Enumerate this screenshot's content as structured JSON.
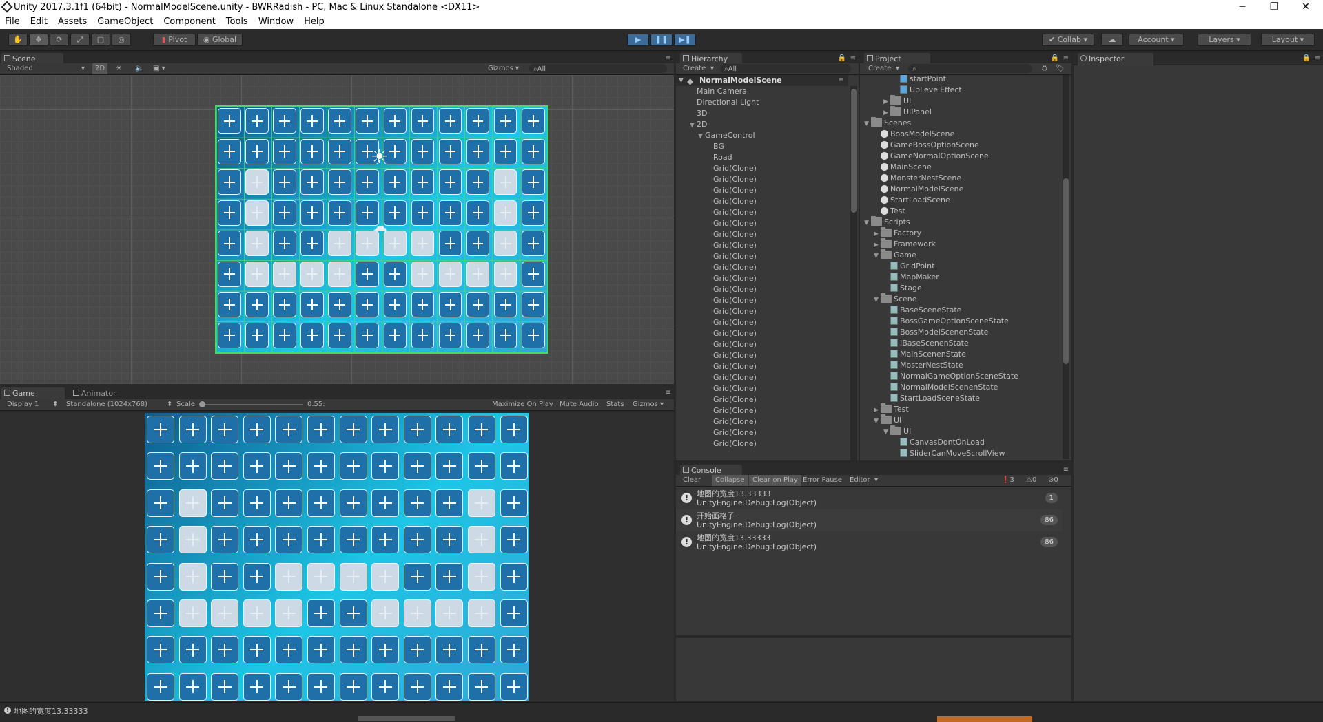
{
  "window": {
    "title": "Unity 2017.3.1f1 (64bit) - NormalModelScene.unity - BWRRadish - PC, Mac & Linux Standalone <DX11>",
    "min": "─",
    "max": "❐",
    "close": "✕"
  },
  "menu": [
    "File",
    "Edit",
    "Assets",
    "GameObject",
    "Component",
    "Tools",
    "Window",
    "Help"
  ],
  "toolbar": {
    "pivot": "Pivot",
    "global": "Global",
    "collab": "Collab",
    "account": "Account",
    "layers": "Layers",
    "layout": "Layout"
  },
  "scene": {
    "tab": "Scene",
    "shading": "Shaded",
    "mode2d": "2D",
    "gizmos": "Gizmos",
    "search": "All"
  },
  "game": {
    "tab": "Game",
    "tab2": "Animator",
    "display": "Display 1",
    "resolution": "Standalone (1024x768)",
    "scale_label": "Scale",
    "scale_value": "0.55:",
    "maximize": "Maximize On Play",
    "mute": "Mute Audio",
    "stats": "Stats",
    "gizmos": "Gizmos"
  },
  "hierarchy": {
    "tab": "Hierarchy",
    "create": "Create",
    "search": "All",
    "scene_name": "NormalModelScene",
    "items": [
      {
        "label": "Main Camera",
        "indent": 1
      },
      {
        "label": "Directional Light",
        "indent": 1
      },
      {
        "label": "3D",
        "indent": 1
      },
      {
        "label": "2D",
        "indent": 1,
        "arrow": "▼"
      },
      {
        "label": "GameControl",
        "indent": 2,
        "arrow": "▼"
      },
      {
        "label": "BG",
        "indent": 3
      },
      {
        "label": "Road",
        "indent": 3
      },
      {
        "label": "Grid(Clone)",
        "indent": 3
      },
      {
        "label": "Grid(Clone)",
        "indent": 3
      },
      {
        "label": "Grid(Clone)",
        "indent": 3
      },
      {
        "label": "Grid(Clone)",
        "indent": 3
      },
      {
        "label": "Grid(Clone)",
        "indent": 3
      },
      {
        "label": "Grid(Clone)",
        "indent": 3
      },
      {
        "label": "Grid(Clone)",
        "indent": 3
      },
      {
        "label": "Grid(Clone)",
        "indent": 3
      },
      {
        "label": "Grid(Clone)",
        "indent": 3
      },
      {
        "label": "Grid(Clone)",
        "indent": 3
      },
      {
        "label": "Grid(Clone)",
        "indent": 3
      },
      {
        "label": "Grid(Clone)",
        "indent": 3
      },
      {
        "label": "Grid(Clone)",
        "indent": 3
      },
      {
        "label": "Grid(Clone)",
        "indent": 3
      },
      {
        "label": "Grid(Clone)",
        "indent": 3
      },
      {
        "label": "Grid(Clone)",
        "indent": 3
      },
      {
        "label": "Grid(Clone)",
        "indent": 3
      },
      {
        "label": "Grid(Clone)",
        "indent": 3
      },
      {
        "label": "Grid(Clone)",
        "indent": 3
      },
      {
        "label": "Grid(Clone)",
        "indent": 3
      },
      {
        "label": "Grid(Clone)",
        "indent": 3
      },
      {
        "label": "Grid(Clone)",
        "indent": 3
      },
      {
        "label": "Grid(Clone)",
        "indent": 3
      },
      {
        "label": "Grid(Clone)",
        "indent": 3
      },
      {
        "label": "Grid(Clone)",
        "indent": 3
      },
      {
        "label": "Grid(Clone)",
        "indent": 3
      }
    ]
  },
  "project": {
    "tab": "Project",
    "create": "Create",
    "items": [
      {
        "label": "startPoint",
        "indent": 3,
        "icon": "prefab"
      },
      {
        "label": "UpLevelEffect",
        "indent": 3,
        "icon": "prefab"
      },
      {
        "label": "UI",
        "indent": 2,
        "icon": "folder",
        "arrow": "▶"
      },
      {
        "label": "UIPanel",
        "indent": 2,
        "icon": "folder",
        "arrow": "▶"
      },
      {
        "label": "Scenes",
        "indent": 0,
        "icon": "folder",
        "arrow": "▼"
      },
      {
        "label": "BoosModelScene",
        "indent": 1,
        "icon": "scene"
      },
      {
        "label": "GameBossOptionScene",
        "indent": 1,
        "icon": "scene"
      },
      {
        "label": "GameNormalOptionScene",
        "indent": 1,
        "icon": "scene"
      },
      {
        "label": "MainScene",
        "indent": 1,
        "icon": "scene"
      },
      {
        "label": "MonsterNestScene",
        "indent": 1,
        "icon": "scene"
      },
      {
        "label": "NormalModelScene",
        "indent": 1,
        "icon": "scene"
      },
      {
        "label": "StartLoadScene",
        "indent": 1,
        "icon": "scene"
      },
      {
        "label": "Test",
        "indent": 1,
        "icon": "scene"
      },
      {
        "label": "Scripts",
        "indent": 0,
        "icon": "folder",
        "arrow": "▼"
      },
      {
        "label": "Factory",
        "indent": 1,
        "icon": "folder",
        "arrow": "▶"
      },
      {
        "label": "Framework",
        "indent": 1,
        "icon": "folder",
        "arrow": "▶"
      },
      {
        "label": "Game",
        "indent": 1,
        "icon": "folder",
        "arrow": "▼"
      },
      {
        "label": "GridPoint",
        "indent": 2,
        "icon": "script"
      },
      {
        "label": "MapMaker",
        "indent": 2,
        "icon": "script"
      },
      {
        "label": "Stage",
        "indent": 2,
        "icon": "script"
      },
      {
        "label": "Scene",
        "indent": 1,
        "icon": "folder",
        "arrow": "▼"
      },
      {
        "label": "BaseSceneState",
        "indent": 2,
        "icon": "script"
      },
      {
        "label": "BossGameOptionSceneState",
        "indent": 2,
        "icon": "script"
      },
      {
        "label": "BossModelScenenState",
        "indent": 2,
        "icon": "script"
      },
      {
        "label": "IBaseScenenState",
        "indent": 2,
        "icon": "script"
      },
      {
        "label": "MainScenenState",
        "indent": 2,
        "icon": "script"
      },
      {
        "label": "MosterNestState",
        "indent": 2,
        "icon": "script"
      },
      {
        "label": "NormalGameOptionSceneState",
        "indent": 2,
        "icon": "script"
      },
      {
        "label": "NormalModelScenenState",
        "indent": 2,
        "icon": "script"
      },
      {
        "label": "StartLoadSceneState",
        "indent": 2,
        "icon": "script"
      },
      {
        "label": "Test",
        "indent": 1,
        "icon": "folder",
        "arrow": "▶"
      },
      {
        "label": "UI",
        "indent": 1,
        "icon": "folder",
        "arrow": "▼"
      },
      {
        "label": "UI",
        "indent": 2,
        "icon": "folder",
        "arrow": "▼"
      },
      {
        "label": "CanvasDontOnLoad",
        "indent": 3,
        "icon": "script"
      },
      {
        "label": "SliderCanMoveScrollView",
        "indent": 3,
        "icon": "script"
      }
    ]
  },
  "inspector": {
    "tab": "Inspector"
  },
  "console": {
    "tab": "Console",
    "buttons": [
      "Clear",
      "Collapse",
      "Clear on Play",
      "Error Pause",
      "Editor"
    ],
    "counts": {
      "info": "3",
      "warn": "0",
      "error": "0"
    },
    "logs": [
      {
        "line1": "地图的宽度13.33333",
        "line2": "UnityEngine.Debug:Log(Object)",
        "count": "1"
      },
      {
        "line1": "开始画格子",
        "line2": "UnityEngine.Debug:Log(Object)",
        "count": "86"
      },
      {
        "line1": "地图的宽度13.33333",
        "line2": "UnityEngine.Debug:Log(Object)",
        "count": "86"
      }
    ]
  },
  "statusbar": {
    "message": "地图的宽度13.33333"
  },
  "colors": {
    "editor_bg": "#282828",
    "panel": "#383838",
    "play_blue": "#3d6b95",
    "grid_blue": "#1f6fa8",
    "grid_green": "#4bd86a"
  }
}
